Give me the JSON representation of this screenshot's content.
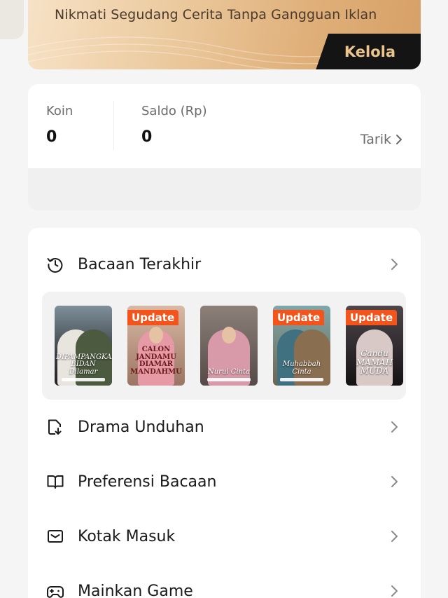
{
  "vip_banner": {
    "text": "Nikmati Segudang Cerita Tanpa Gangguan Iklan",
    "button_label": "Kelola"
  },
  "wallet": {
    "coin_label": "Koin",
    "coin_value": "0",
    "balance_label": "Saldo (Rp)",
    "balance_value": "0",
    "withdraw_label": "Tarik"
  },
  "menu": {
    "recent": {
      "label": "Bacaan Terakhir",
      "icon": "history-icon"
    },
    "downloads": {
      "label": "Drama Unduhan",
      "icon": "download-icon"
    },
    "preferences": {
      "label": "Preferensi Bacaan",
      "icon": "book-open-icon"
    },
    "inbox": {
      "label": "Kotak Masuk",
      "icon": "mail-icon"
    },
    "games": {
      "label": "Mainkan Game",
      "icon": "gamepad-icon"
    }
  },
  "recent_books": [
    {
      "badge": "",
      "title": "DIPAMPANGKAN BIDAN Dilamar",
      "colors": [
        "#5b6f7a",
        "#2b3238"
      ]
    },
    {
      "badge": "Update",
      "title": "CALON JANDAMU DIAMAR MANDAHMU",
      "colors": [
        "#caa28d",
        "#7d5b4d"
      ]
    },
    {
      "badge": "",
      "title": "Nurul Cinta",
      "colors": [
        "#7a6e68",
        "#463c3a"
      ]
    },
    {
      "badge": "Update",
      "title": "Muhabbah Cinta",
      "colors": [
        "#3f6e7a",
        "#6b5a48"
      ]
    },
    {
      "badge": "Update",
      "title": "Candu MAMAH MUDA",
      "colors": [
        "#3a3438",
        "#151214"
      ]
    }
  ],
  "colors": {
    "accent": "#f2541b",
    "gold": "#ecc48d",
    "banner_dark": "#141414"
  }
}
